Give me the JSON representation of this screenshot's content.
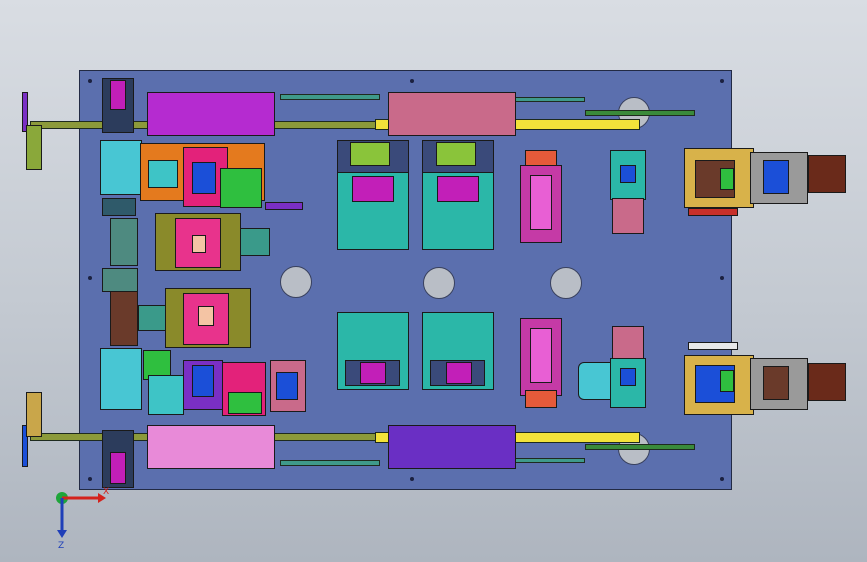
{
  "viewport": {
    "background_top": "#d9dde3",
    "background_bottom": "#aeb5bf",
    "plate_color": "#5b6fae"
  },
  "triad": {
    "x_label": "X",
    "z_label": "Z",
    "x_color": "#d4221c",
    "y_color": "#1ea53a",
    "z_color": "#1f3fb8"
  },
  "palette": {
    "magenta": "#c21fb8",
    "purple": "#7a2fc4",
    "pink": "#e05fa8",
    "teal": "#2bb7a8",
    "yellow": "#f2e23a",
    "olive": "#8a8a2a",
    "orange": "#e47a1e",
    "green": "#2fbf3f",
    "brown": "#6a3a2a",
    "cyan": "#4fc7d6"
  }
}
